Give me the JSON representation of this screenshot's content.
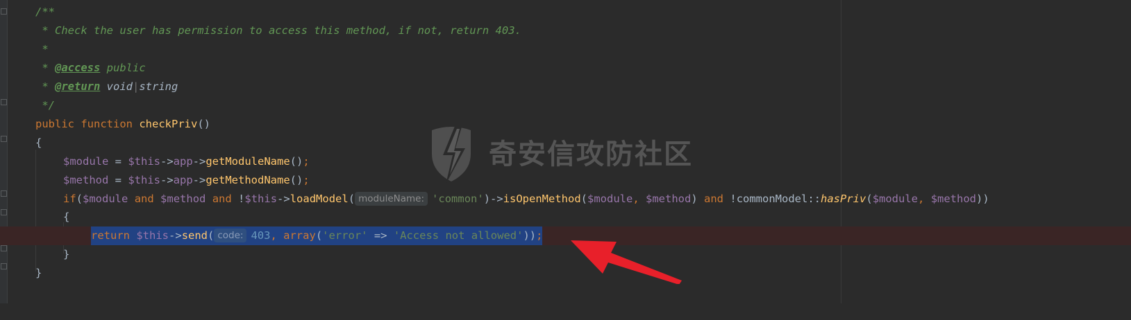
{
  "editor": {
    "theme_colors": {
      "background": "#2b2b2b",
      "keyword": "#cc7832",
      "function": "#ffc66d",
      "variable": "#9876aa",
      "string": "#6a8759",
      "number": "#6897bb",
      "comment": "#629755",
      "selection": "#214283",
      "annotation_arrow": "#e8202a"
    },
    "lines": {
      "l1": {
        "t1": "/**"
      },
      "l2": {
        "t1": " * Check the user has permission to access this method, if not, return 403."
      },
      "l3": {
        "t1": " *"
      },
      "l4": {
        "t1": " * ",
        "t2": "@access",
        "t3": " public"
      },
      "l5": {
        "t1": " * ",
        "t2": "@return",
        "t3": " void",
        "t4": "|",
        "t5": "string"
      },
      "l6": {
        "t1": " */"
      },
      "l7": {
        "t1": "public",
        "t2": " ",
        "t3": "function",
        "t4": " ",
        "t5": "checkPriv",
        "t6": "()"
      },
      "l8": {
        "t1": "{"
      },
      "l9": {
        "t1": "$module",
        "t2": " = ",
        "t3": "$this",
        "t4": "->",
        "t5": "app",
        "t6": "->",
        "t7": "getModuleName",
        "t8": "()",
        "t9": ";"
      },
      "l10": {
        "t1": "$method",
        "t2": " = ",
        "t3": "$this",
        "t4": "->",
        "t5": "app",
        "t6": "->",
        "t7": "getMethodName",
        "t8": "()",
        "t9": ";"
      },
      "l11": {
        "t1": "if",
        "t2": "(",
        "t3": "$module",
        "t4": " ",
        "t5": "and",
        "t6": " ",
        "t7": "$method",
        "t8": " ",
        "t9": "and",
        "t10": " !",
        "t11": "$this",
        "t12": "->",
        "t13": "loadModel",
        "t14": "(",
        "hint": "moduleName:",
        "t15": "'common'",
        "t16": ")->",
        "t17": "isOpenMethod",
        "t18": "(",
        "t19": "$module",
        "t20": ", ",
        "t21": "$method",
        "t22": ") ",
        "t23": "and",
        "t24": " !",
        "t25": "commonModel",
        "t26": "::",
        "t27": "hasPriv",
        "t28": "(",
        "t29": "$module",
        "t30": ", ",
        "t31": "$method",
        "t32": "))"
      },
      "l12": {
        "t1": "{"
      },
      "l13": {
        "t1": "return",
        "t2": " ",
        "t3": "$this",
        "t4": "->",
        "t5": "send",
        "t6": "(",
        "hint": "code:",
        "t7": "403",
        "t8": ", ",
        "t9": "array",
        "t10": "(",
        "t11": "'error'",
        "t12": " => ",
        "t13": "'Access not allowed'",
        "t14": "))",
        "t15": ";"
      },
      "l14": {
        "t1": "}"
      },
      "l15": {
        "t1": "}"
      }
    }
  },
  "watermark": {
    "text": "奇安信攻防社区",
    "logo_icon": "lightning-shield-icon"
  },
  "annotation": {
    "icon": "red-arrow-icon"
  }
}
